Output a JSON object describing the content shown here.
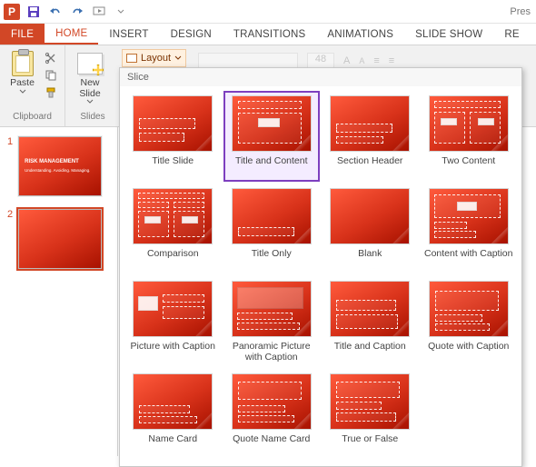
{
  "titlebar": {
    "document_name": "Pres"
  },
  "qat": {
    "save": "💾",
    "undo": "↶",
    "redo": "↷",
    "start": "▷"
  },
  "tabs": {
    "file": "FILE",
    "items": [
      "HOME",
      "INSERT",
      "DESIGN",
      "TRANSITIONS",
      "ANIMATIONS",
      "SLIDE SHOW",
      "RE"
    ],
    "active_index": 0
  },
  "ribbon": {
    "clipboard": {
      "paste": "Paste",
      "group": "Clipboard"
    },
    "slides": {
      "new_slide": "New\nSlide",
      "layout": "Layout",
      "group": "Slides"
    },
    "font_size": "48"
  },
  "gallery": {
    "theme": "Slice",
    "layouts": [
      "Title Slide",
      "Title and Content",
      "Section Header",
      "Two Content",
      "Comparison",
      "Title Only",
      "Blank",
      "Content with Caption",
      "Picture with Caption",
      "Panoramic Picture with Caption",
      "Title and Caption",
      "Quote with Caption",
      "Name Card",
      "Quote Name Card",
      "True or False"
    ],
    "selected_index": 1
  },
  "slides_panel": {
    "items": [
      {
        "n": "1",
        "title": "RISK MANAGEMENT",
        "subtitle": "Understanding. Avoiding. Managing."
      },
      {
        "n": "2",
        "title": "",
        "subtitle": ""
      }
    ]
  }
}
